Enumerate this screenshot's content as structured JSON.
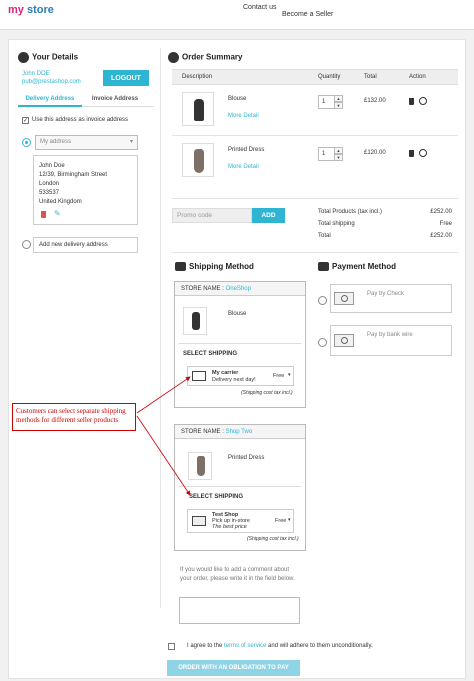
{
  "header": {
    "logo_my": "my",
    "logo_store": "store",
    "nav": [
      "Contact us",
      "Become a Seller"
    ]
  },
  "your_details": {
    "title": "Your Details",
    "user_name": "John DOE",
    "user_email": "pub@prestashop.com",
    "logout_label": "LOGOUT",
    "tabs": [
      "Delivery Address",
      "Invoice Address"
    ],
    "use_same_label": "Use this address as invoice address",
    "address_select": "My address",
    "address_lines": [
      "John Doe",
      "12/39, Birmingham Street",
      "London",
      "533537",
      "United Kingdom"
    ],
    "add_new_label": "Add new delivery address"
  },
  "order_summary": {
    "title": "Order Summary",
    "columns": [
      "Description",
      "Quantity",
      "Total",
      "Action"
    ],
    "items": [
      {
        "name": "Blouse",
        "more": "More Detail",
        "qty": "1",
        "total": "£132.00"
      },
      {
        "name": "Printed Dress",
        "more": "More Detail",
        "qty": "1",
        "total": "£120.00"
      }
    ],
    "promo_placeholder": "Promo code",
    "promo_button": "ADD",
    "totals": [
      {
        "label": "Total Products (tax incl.)",
        "value": "£252.00"
      },
      {
        "label": "Total shipping",
        "value": "Free"
      },
      {
        "label": "Total",
        "value": "£252.00"
      }
    ]
  },
  "shipping": {
    "title": "Shipping Method",
    "stores": [
      {
        "store_label": "STORE NAME : ",
        "store_name": "OneShop",
        "product": "Blouse",
        "select_label": "SELECT SHIPPING",
        "carrier_name": "My carrier",
        "carrier_desc": "Delivery next day!",
        "price": "Free",
        "note": "(Shipping cost tax incl.)"
      },
      {
        "store_label": "STORE NAME : ",
        "store_name": "Shop Two",
        "product": "Printed Dress",
        "select_label": "SELECT SHIPPING",
        "carrier_name": "Test Shop",
        "carrier_desc": "Pick up in-store",
        "carrier_desc2": "The best price",
        "price": "Free",
        "note": "(Shipping cost tax incl.)"
      }
    ],
    "comment_prompt": "If you would like to add a comment about your order, please write it in the field below."
  },
  "payment": {
    "title": "Payment Method",
    "options": [
      "Pay by Check",
      "Pay by bank wire"
    ]
  },
  "terms": {
    "prefix": "I agree to the ",
    "link": "terms of service",
    "suffix": " and will adhere to them unconditionally."
  },
  "order_button": "ORDER WITH AN OBLIGATION TO PAY",
  "annotation_text": "Customers can select separate shipping methods for different seller products",
  "colors": {
    "accent": "#2fb5d2",
    "logo_pink": "#e0217a",
    "annotation": "#cc0000"
  }
}
